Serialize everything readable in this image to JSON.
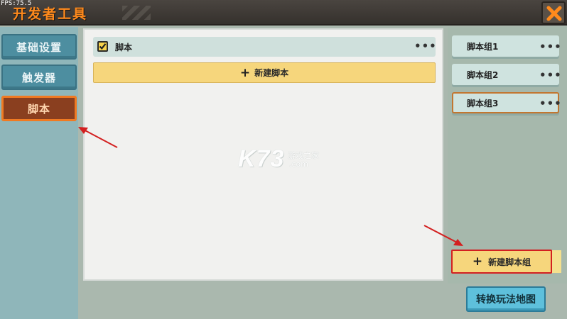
{
  "overlay": {
    "fps": "FPS:75.5"
  },
  "window": {
    "title": "开发者工具",
    "close_icon": "close-x-icon"
  },
  "sidebar": {
    "tabs": [
      {
        "label": "基础设置",
        "active": false
      },
      {
        "label": "触发器",
        "active": false
      },
      {
        "label": "脚本",
        "active": true
      }
    ]
  },
  "scripts": {
    "items": [
      {
        "label": "脚本",
        "checked": true,
        "menu": "•••"
      }
    ],
    "new_label": "新建脚本"
  },
  "groups": {
    "items": [
      {
        "label": "脚本组1",
        "menu": "•••",
        "selected": false
      },
      {
        "label": "脚本组2",
        "menu": "•••",
        "selected": false
      },
      {
        "label": "脚本组3",
        "menu": "•••",
        "selected": true
      }
    ],
    "new_label": "新建脚本组"
  },
  "footer": {
    "switch_label": "转换玩法地图"
  },
  "watermark": {
    "logo": "K73",
    "cn": "游戏之家",
    "domain": ".com"
  },
  "colors": {
    "title": "#ff8a1c",
    "tab_normal": "#4d8ea0",
    "tab_active": "#8a3f1f",
    "accent_yellow": "#f6d67c",
    "switch_button": "#5ec0dc",
    "annotation_red": "#d32020"
  }
}
